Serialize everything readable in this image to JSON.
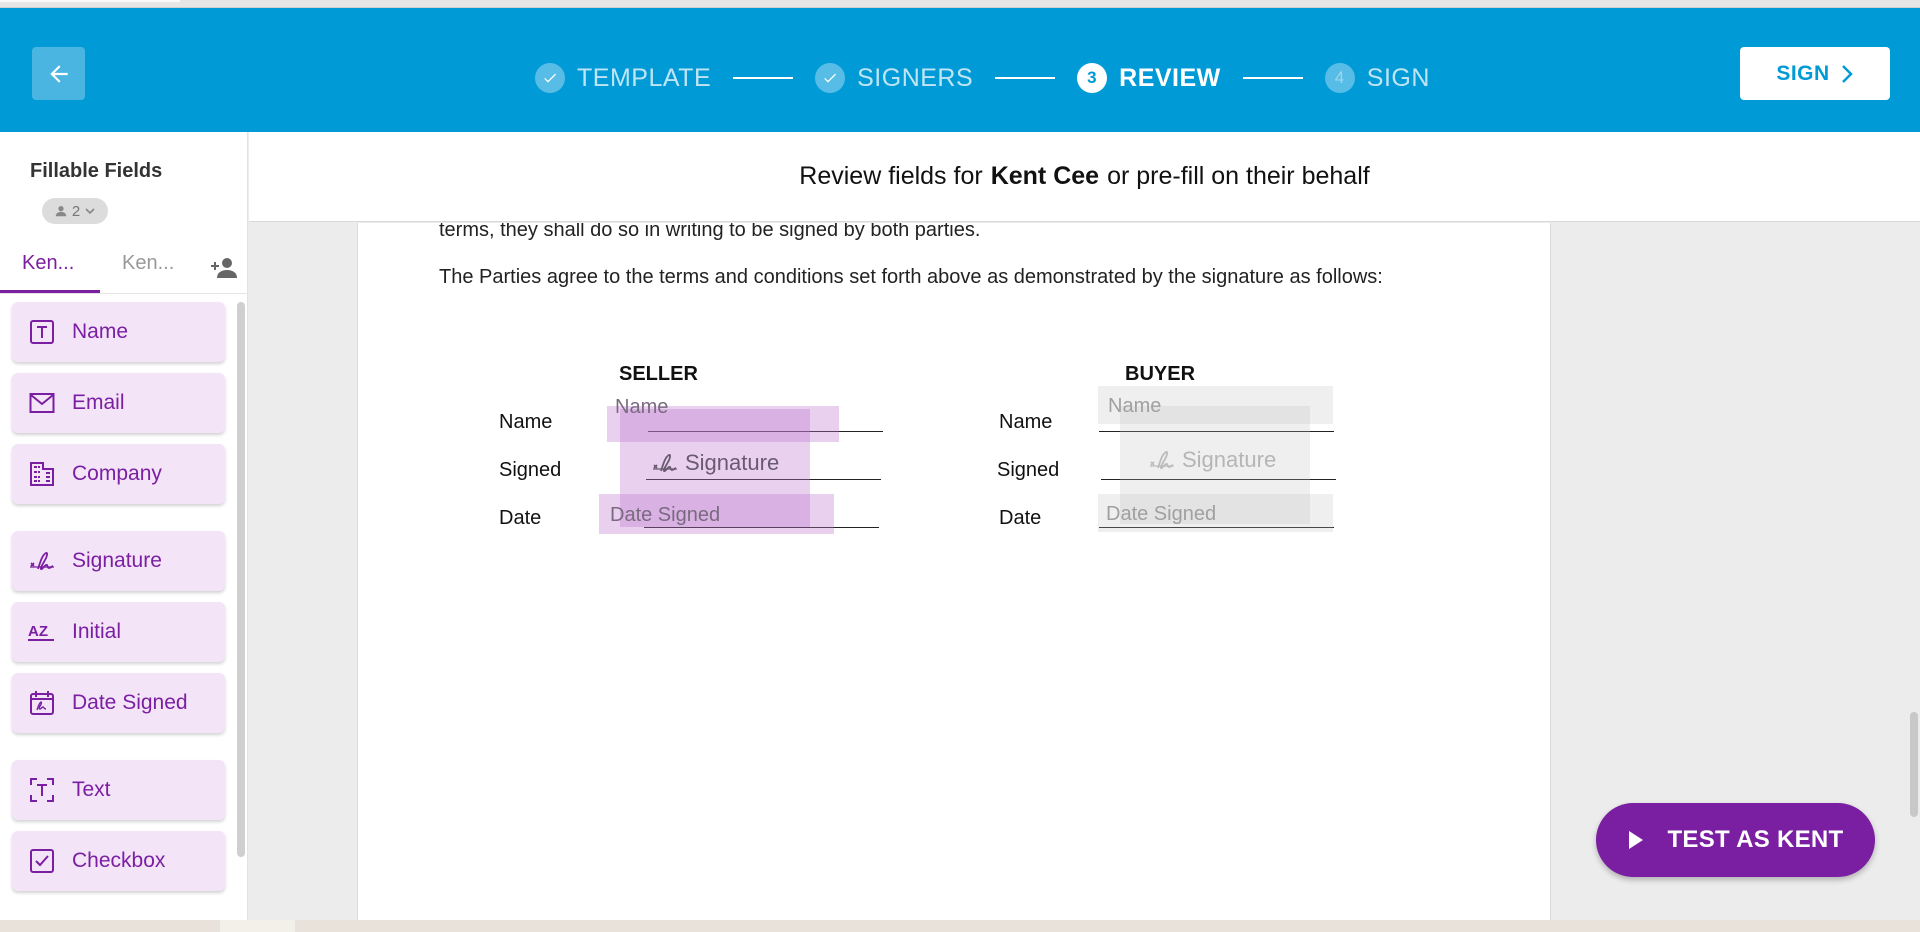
{
  "header": {
    "steps": [
      {
        "label": "TEMPLATE",
        "state": "done"
      },
      {
        "label": "SIGNERS",
        "state": "done"
      },
      {
        "label": "REVIEW",
        "number": "3",
        "state": "active"
      },
      {
        "label": "SIGN",
        "number": "4",
        "state": "future"
      }
    ],
    "sign_button_label": "SIGN",
    "brand_color": "#009bd7"
  },
  "sidebar": {
    "title": "Fillable Fields",
    "signer_count": "2",
    "signer_tabs": [
      {
        "label": "Ken...",
        "active": true
      },
      {
        "label": "Ken...",
        "active": false
      }
    ],
    "fields": [
      {
        "label": "Name",
        "icon": "text-box-icon"
      },
      {
        "label": "Email",
        "icon": "envelope-icon"
      },
      {
        "label": "Company",
        "icon": "building-icon"
      },
      {
        "label": "Signature",
        "icon": "signature-icon"
      },
      {
        "label": "Initial",
        "icon": "az-initial-icon"
      },
      {
        "label": "Date Signed",
        "icon": "calendar-signature-icon"
      },
      {
        "label": "Text",
        "icon": "text-bracket-icon"
      },
      {
        "label": "Checkbox",
        "icon": "checkbox-icon"
      }
    ],
    "accent_color": "#7b1fa2"
  },
  "review_bar": {
    "prefix": "Review fields for",
    "signer_name": "Kent Cee",
    "suffix": "or pre-fill on their behalf"
  },
  "document": {
    "line1": "terms, they shall do so in writing to be signed by both parties.",
    "line2": "The Parties agree to the terms and conditions set forth above as demonstrated by the signature as follows:",
    "seller": {
      "heading": "SELLER",
      "labels": [
        "Name",
        "Signed",
        "Date"
      ],
      "placeholders": {
        "name": "Name",
        "signature": "Signature",
        "date": "Date Signed"
      }
    },
    "buyer": {
      "heading": "BUYER",
      "labels": [
        "Name",
        "Signed",
        "Date"
      ],
      "placeholders": {
        "name": "Name",
        "signature": "Signature",
        "date": "Date Signed"
      }
    }
  },
  "test_button_label": "TEST AS KENT"
}
